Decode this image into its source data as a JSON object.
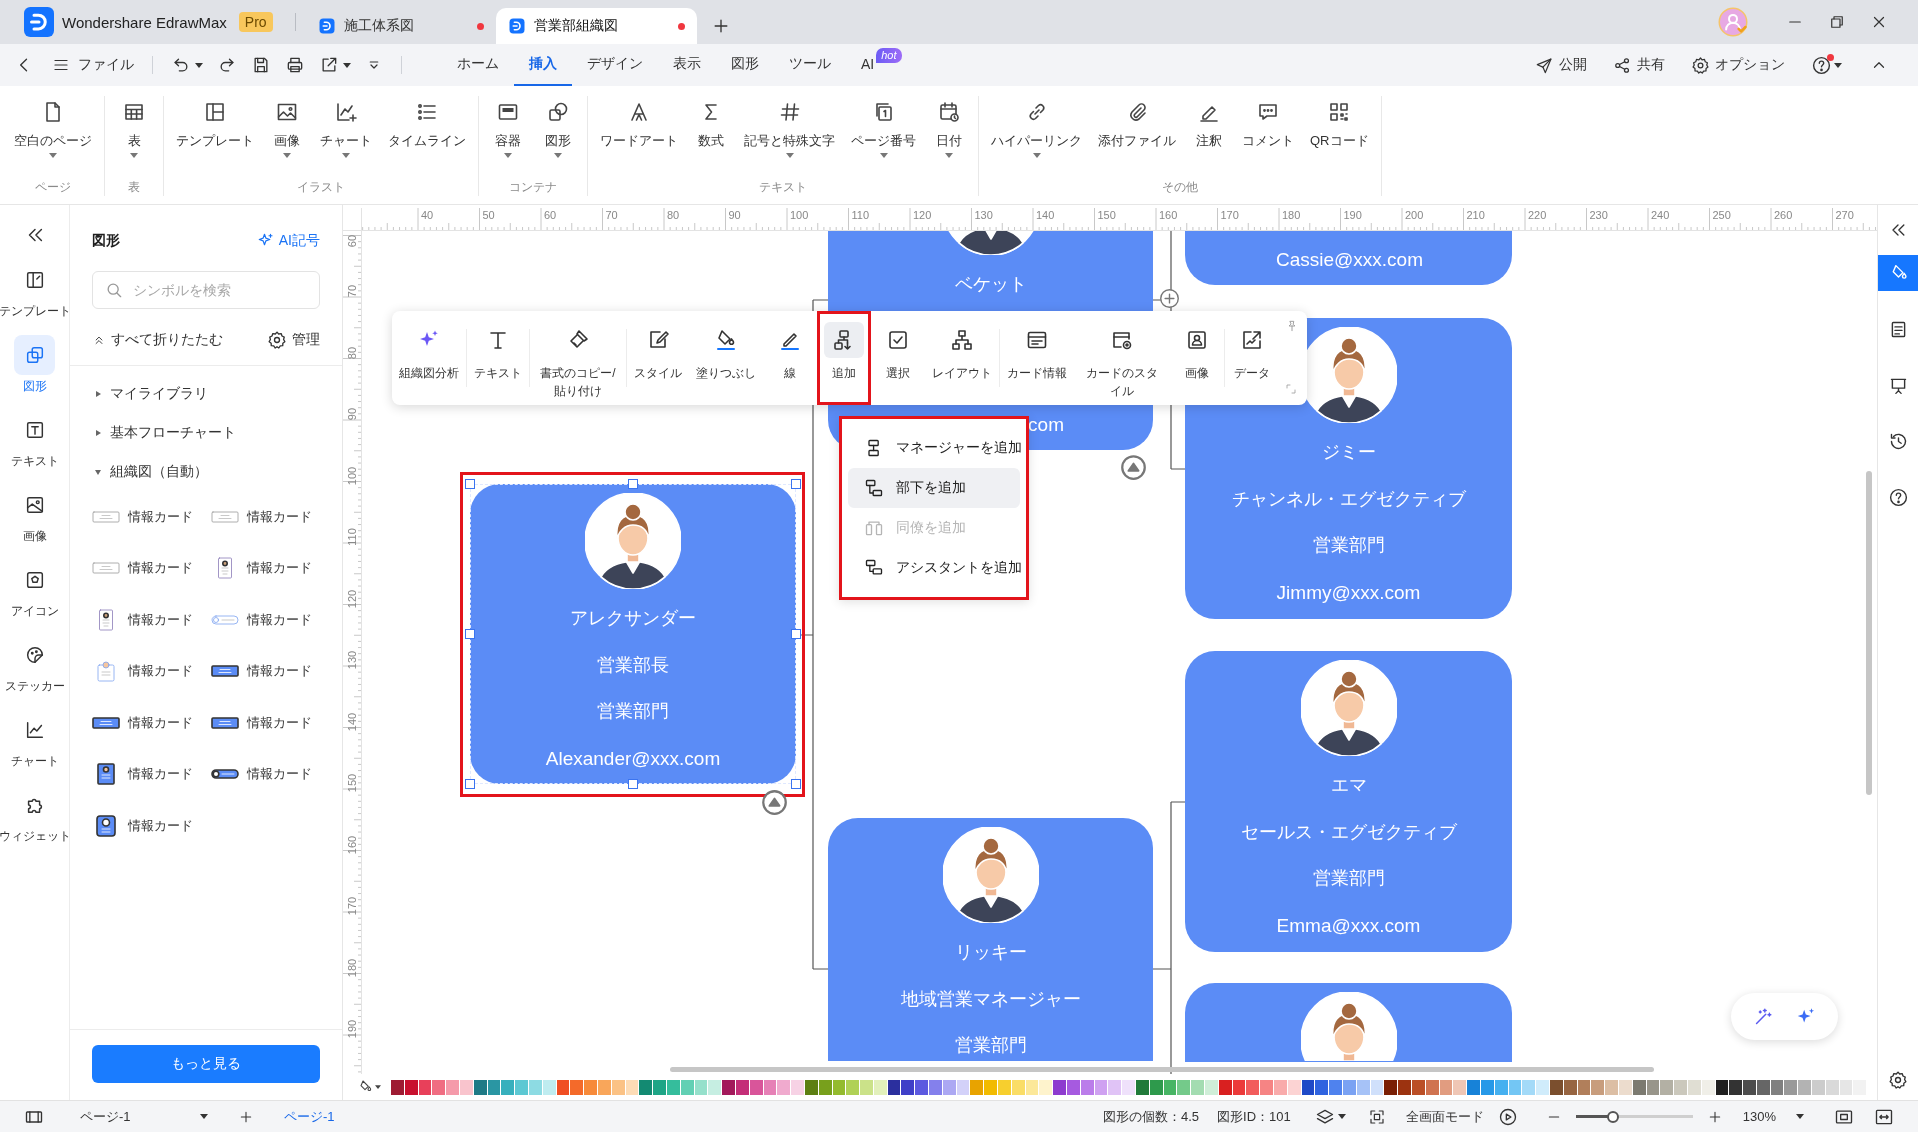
{
  "title_bar": {
    "app_name": "Wondershare EdrawMax",
    "badge": "Pro",
    "tabs": [
      {
        "title": "施工体系図",
        "selected": false,
        "unsaved": true
      },
      {
        "title": "営業部組織図",
        "selected": true,
        "unsaved": true
      }
    ]
  },
  "menu_bar": {
    "file": "ファイル",
    "tabs": [
      {
        "label": "ホーム",
        "selected": false
      },
      {
        "label": "挿入",
        "selected": true
      },
      {
        "label": "デザイン",
        "selected": false
      },
      {
        "label": "表示",
        "selected": false
      },
      {
        "label": "図形",
        "selected": false
      },
      {
        "label": "ツール",
        "selected": false
      },
      {
        "label": "AI",
        "selected": false,
        "badge": "hot"
      }
    ],
    "actions": [
      "公開",
      "共有",
      "オプション"
    ],
    "help_notification": true
  },
  "ribbon": {
    "groups": [
      {
        "label": "ページ",
        "items": [
          {
            "label": "空白のページ",
            "dropdown": true
          }
        ]
      },
      {
        "label": "表",
        "items": [
          {
            "label": "表",
            "dropdown": true
          }
        ]
      },
      {
        "label": "イラスト",
        "items": [
          {
            "label": "テンプレート",
            "dropdown": false
          },
          {
            "label": "画像",
            "dropdown": true
          },
          {
            "label": "チャート",
            "dropdown": true
          },
          {
            "label": "タイムライン",
            "dropdown": false
          }
        ]
      },
      {
        "label": "コンテナ",
        "items": [
          {
            "label": "容器",
            "dropdown": true
          },
          {
            "label": "図形",
            "dropdown": true
          }
        ]
      },
      {
        "label": "テキスト",
        "items": [
          {
            "label": "ワードアート",
            "dropdown": false
          },
          {
            "label": "数式",
            "dropdown": false
          },
          {
            "label": "記号と特殊文字",
            "dropdown": true
          },
          {
            "label": "ページ番号",
            "dropdown": true
          },
          {
            "label": "日付",
            "dropdown": true
          }
        ]
      },
      {
        "label": "その他",
        "items": [
          {
            "label": "ハイパーリンク",
            "dropdown": true
          },
          {
            "label": "添付ファイル",
            "dropdown": false
          },
          {
            "label": "注釈",
            "dropdown": false
          },
          {
            "label": "コメント",
            "dropdown": false
          },
          {
            "label": "QRコード",
            "dropdown": false
          }
        ]
      }
    ]
  },
  "left_rail": {
    "items": [
      {
        "label": "テンプレート",
        "selected": false
      },
      {
        "label": "図形",
        "selected": true
      },
      {
        "label": "テキスト",
        "selected": false
      },
      {
        "label": "画像",
        "selected": false
      },
      {
        "label": "アイコン",
        "selected": false
      },
      {
        "label": "ステッカー",
        "selected": false
      },
      {
        "label": "チャート",
        "selected": false
      },
      {
        "label": "ウィジェット",
        "selected": false
      }
    ]
  },
  "shape_panel": {
    "title": "図形",
    "ai_button": "AI記号",
    "search": {
      "placeholder": "シンボルを検索"
    },
    "collapse_all": "すべて折りたたむ",
    "manage": "管理",
    "libraries": [
      {
        "label": "マイライブラリ",
        "expanded": false
      },
      {
        "label": "基本フローチャート",
        "expanded": false
      },
      {
        "label": "組織図（自動）",
        "expanded": true,
        "children": [
          {
            "label": "情報カード",
            "kind": "wide"
          },
          {
            "label": "情報カード",
            "kind": "wide"
          },
          {
            "label": "情報カード",
            "kind": "wide"
          },
          {
            "label": "情報カード",
            "kind": "tall"
          },
          {
            "label": "情報カード",
            "kind": "tall"
          },
          {
            "label": "情報カード",
            "kind": "pill"
          },
          {
            "label": "情報カード",
            "kind": "badge"
          },
          {
            "label": "情報カード",
            "kind": "bluewide"
          },
          {
            "label": "情報カード",
            "kind": "bluewide"
          },
          {
            "label": "情報カード",
            "kind": "bluewide"
          },
          {
            "label": "情報カード",
            "kind": "bluetall"
          },
          {
            "label": "情報カード",
            "kind": "bluepill"
          },
          {
            "label": "情報カード",
            "kind": "bluesquare"
          }
        ]
      }
    ],
    "more_button": "もっと見る"
  },
  "canvas": {
    "rulers": {
      "horizontal": [
        "40",
        "50",
        "60",
        "70",
        "80",
        "90",
        "100",
        "110",
        "120",
        "130",
        "140",
        "150",
        "160",
        "170",
        "180",
        "190",
        "200",
        "210",
        "220",
        "230",
        "240",
        "250",
        "260",
        "270"
      ],
      "vertical": [
        "60",
        "70",
        "80",
        "90",
        "100",
        "110",
        "120",
        "130",
        "140",
        "150",
        "160",
        "170",
        "180",
        "190"
      ]
    },
    "cards": [
      {
        "kind": "topcut",
        "avatar": true,
        "name": "ベケット",
        "email": "com",
        "selected": false,
        "highlighted": false
      },
      {
        "kind": "topcut",
        "email": "Cassie@xxx.com",
        "selected": false,
        "highlighted": false
      },
      {
        "kind": "full",
        "avatar": true,
        "name": "ジミー",
        "title": "チャンネル・エグゼクティブ",
        "department": "営業部門",
        "email": "Jimmy@xxx.com",
        "selected": false,
        "highlighted": false
      },
      {
        "kind": "full",
        "avatar": true,
        "name": "アレクサンダー",
        "title": "営業部長",
        "department": "営業部門",
        "email": "Alexander@xxx.com",
        "selected": true,
        "highlighted": true
      },
      {
        "kind": "full",
        "avatar": true,
        "name": "エマ",
        "title": "セールス・エグゼクティブ",
        "department": "営業部門",
        "email": "Emma@xxx.com",
        "selected": false,
        "highlighted": false
      },
      {
        "kind": "bottomcut",
        "avatar": true,
        "name": "リッキー",
        "title": "地域営業マネージャー",
        "department": "営業部門",
        "selected": false,
        "highlighted": false
      },
      {
        "kind": "peek",
        "avatar": true,
        "selected": false,
        "highlighted": false
      }
    ],
    "toolbar": {
      "groups": [
        [
          {
            "label": "組織図分析",
            "selected": false,
            "highlighted": false
          }
        ],
        [
          {
            "label": "テキスト",
            "selected": false,
            "highlighted": false
          }
        ],
        [
          {
            "label": "書式のコピー/貼り付け",
            "selected": false,
            "highlighted": false
          }
        ],
        [
          {
            "label": "スタイル",
            "selected": false,
            "highlighted": false
          },
          {
            "label": "塗りつぶし",
            "selected": false,
            "highlighted": false
          },
          {
            "label": "線",
            "selected": false,
            "highlighted": false
          },
          {
            "label": "追加",
            "selected": true,
            "highlighted": true
          },
          {
            "label": "選択",
            "selected": false,
            "highlighted": false
          },
          {
            "label": "レイアウト",
            "selected": false,
            "highlighted": false
          }
        ],
        [
          {
            "label": "カード情報",
            "selected": false,
            "highlighted": false
          },
          {
            "label": "カードのスタイル",
            "selected": false,
            "highlighted": false
          },
          {
            "label": "画像",
            "selected": false,
            "highlighted": false
          }
        ],
        [
          {
            "label": "データ",
            "selected": false,
            "highlighted": false
          }
        ]
      ]
    },
    "add_menu": {
      "highlighted": true,
      "items": [
        {
          "label": "マネージャーを追加",
          "hovered": false,
          "disabled": false
        },
        {
          "label": "部下を追加",
          "hovered": true,
          "disabled": false
        },
        {
          "label": "同僚を追加",
          "hovered": false,
          "disabled": true
        },
        {
          "label": "アシスタントを追加",
          "hovered": false,
          "disabled": false
        }
      ]
    }
  },
  "palette": {
    "colors": [
      {
        "color": "#9e1b32"
      },
      {
        "color": "#c8102e"
      },
      {
        "color": "#e8405a"
      },
      {
        "color": "#f06d82"
      },
      {
        "color": "#f59aaa"
      },
      {
        "color": "#f9c4cd"
      },
      {
        "color": "#1f7a86"
      },
      {
        "color": "#2a96a3"
      },
      {
        "color": "#37b0bd"
      },
      {
        "color": "#5cc8d3"
      },
      {
        "color": "#8ddbe3"
      },
      {
        "color": "#bfecf0"
      },
      {
        "color": "#f04e23"
      },
      {
        "color": "#f46a2a"
      },
      {
        "color": "#f78a3a"
      },
      {
        "color": "#f9a65a"
      },
      {
        "color": "#fbc285"
      },
      {
        "color": "#fddcb6"
      },
      {
        "color": "#138a72"
      },
      {
        "color": "#1ea586"
      },
      {
        "color": "#35bd9c"
      },
      {
        "color": "#62d0b4"
      },
      {
        "color": "#95e0cb"
      },
      {
        "color": "#c6eee2"
      },
      {
        "color": "#a3195b"
      },
      {
        "color": "#c42e78"
      },
      {
        "color": "#d9559a"
      },
      {
        "color": "#e680b6"
      },
      {
        "color": "#f0aace"
      },
      {
        "color": "#f7d2e5"
      },
      {
        "color": "#5d7f12"
      },
      {
        "color": "#78a01c"
      },
      {
        "color": "#94bb2e"
      },
      {
        "color": "#b0d156"
      },
      {
        "color": "#cbe289"
      },
      {
        "color": "#e2f0bb"
      },
      {
        "color": "#2b2f9e"
      },
      {
        "color": "#3f3fc8"
      },
      {
        "color": "#5c59e0"
      },
      {
        "color": "#8480ec"
      },
      {
        "color": "#aca8f3"
      },
      {
        "color": "#d3d1f9"
      },
      {
        "color": "#e8a300"
      },
      {
        "color": "#f2bb00"
      },
      {
        "color": "#f7cf2e"
      },
      {
        "color": "#fadd66"
      },
      {
        "color": "#fce899"
      },
      {
        "color": "#fef3cc"
      },
      {
        "color": "#8e3bcf"
      },
      {
        "color": "#a65ae0"
      },
      {
        "color": "#bb7dea"
      },
      {
        "color": "#cfa1f1"
      },
      {
        "color": "#e0c3f6"
      },
      {
        "color": "#efe1fb"
      },
      {
        "color": "#217a3a"
      },
      {
        "color": "#2e9a4c"
      },
      {
        "color": "#47b564"
      },
      {
        "color": "#74ca8a"
      },
      {
        "color": "#a3dcb1"
      },
      {
        "color": "#cfeed8"
      },
      {
        "color": "#d92020"
      },
      {
        "color": "#ec3a3a"
      },
      {
        "color": "#f25c5c"
      },
      {
        "color": "#f68484"
      },
      {
        "color": "#f9abab"
      },
      {
        "color": "#fcd3d3"
      },
      {
        "color": "#1f49c7"
      },
      {
        "color": "#2f63e0"
      },
      {
        "color": "#4f82ee"
      },
      {
        "color": "#7aa2f3"
      },
      {
        "color": "#a6c2f7"
      },
      {
        "color": "#d0e0fb"
      },
      {
        "color": "#7a1f05"
      },
      {
        "color": "#9c3310"
      },
      {
        "color": "#bb4f26"
      },
      {
        "color": "#d07350"
      },
      {
        "color": "#e19c80"
      },
      {
        "color": "#efc6b5"
      },
      {
        "color": "#1782d8"
      },
      {
        "color": "#2799e8"
      },
      {
        "color": "#45b0f0"
      },
      {
        "color": "#73c6f4"
      },
      {
        "color": "#a3daf8"
      },
      {
        "color": "#d0ecfb"
      },
      {
        "color": "#7b4f2e"
      },
      {
        "color": "#976541"
      },
      {
        "color": "#b17f5b"
      },
      {
        "color": "#c89d7d"
      },
      {
        "color": "#dcbea4"
      },
      {
        "color": "#ecdccd"
      },
      {
        "color": "#7c7a70"
      },
      {
        "color": "#98958a"
      },
      {
        "color": "#b3b0a4"
      },
      {
        "color": "#cbc8bc"
      },
      {
        "color": "#e0ded3"
      },
      {
        "color": "#f0efe8"
      },
      {
        "color": "#1f1f1f"
      },
      {
        "color": "#333333"
      },
      {
        "color": "#4d4d4d"
      },
      {
        "color": "#666666"
      },
      {
        "color": "#808080"
      },
      {
        "color": "#999999"
      },
      {
        "color": "#b3b3b3"
      },
      {
        "color": "#cccccc"
      },
      {
        "color": "#d9d9d9"
      },
      {
        "color": "#e6e6e6"
      },
      {
        "color": "#f2f2f2"
      }
    ]
  },
  "right_rail": {
    "tools": [
      {
        "selected": true
      },
      {
        "selected": false
      },
      {
        "selected": false
      },
      {
        "selected": false
      },
      {
        "selected": false
      }
    ]
  },
  "status_bar": {
    "page_select": "ページ-1",
    "page_tabs": [
      {
        "label": "ページ-1",
        "selected": true
      }
    ],
    "shape_count": "図形の個数：4.5",
    "shape_id": "図形ID：101",
    "fullscreen": "全画面モード",
    "zoom": {
      "level": 0.32,
      "value": "130%"
    }
  }
}
